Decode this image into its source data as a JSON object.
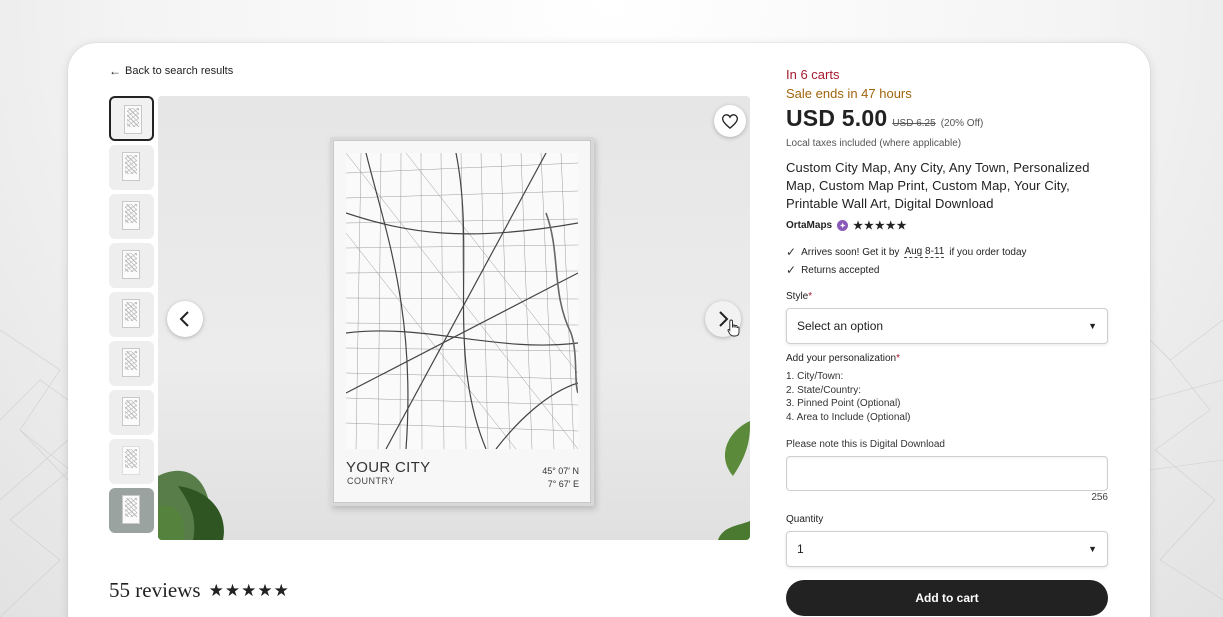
{
  "back_link": {
    "label": "Back to search results",
    "icon": "arrow-left-icon"
  },
  "thumbnails": [
    {
      "label": "",
      "active": true
    },
    {
      "label": "",
      "active": false
    },
    {
      "label": "",
      "active": false
    },
    {
      "label": "",
      "active": false
    },
    {
      "label": "",
      "active": false
    },
    {
      "label": "",
      "active": false
    },
    {
      "label": "",
      "active": false
    },
    {
      "label": "",
      "active": false
    },
    {
      "label": "",
      "active": false
    }
  ],
  "poster": {
    "city": "YOUR CITY",
    "country": "COUNTRY",
    "coord_lat": "45° 07′ N",
    "coord_lon": "7° 67′ E"
  },
  "reviews": {
    "count_label": "55 reviews",
    "stars": 5
  },
  "listing": {
    "in_carts": "In 6 carts",
    "sale_ends": "Sale ends in 47 hours",
    "price": "USD 5.00",
    "old_price": "USD 6.25",
    "discount": "(20% Off)",
    "taxes": "Local taxes included (where applicable)",
    "title": "Custom City Map, Any City, Any Town, Personalized Map, Custom Map Print, Custom Map, Your City, Printable Wall Art, Digital Download",
    "shop_name": "OrtaMaps",
    "shop_stars": 5
  },
  "shipping": {
    "arrives_prefix": "Arrives soon! Get it by",
    "arrives_dates": "Aug 8-11",
    "arrives_suffix": "if you order today",
    "returns": "Returns accepted"
  },
  "style": {
    "label": "Style",
    "required_mark": "*",
    "value": "Select an option"
  },
  "personalization": {
    "label": "Add your personalization",
    "required_mark": "*",
    "lines": [
      "1. City/Town:",
      "2. State/Country:",
      "3. Pinned Point (Optional)",
      "4. Area to Include (Optional)"
    ],
    "note": "Please note this is Digital Download",
    "char_count": "256"
  },
  "quantity": {
    "label": "Quantity",
    "value": "1"
  },
  "add_to_cart_label": "Add to cart",
  "colors": {
    "in_carts": "#a61a2e",
    "sale": "#a0650d",
    "button": "#222222"
  }
}
